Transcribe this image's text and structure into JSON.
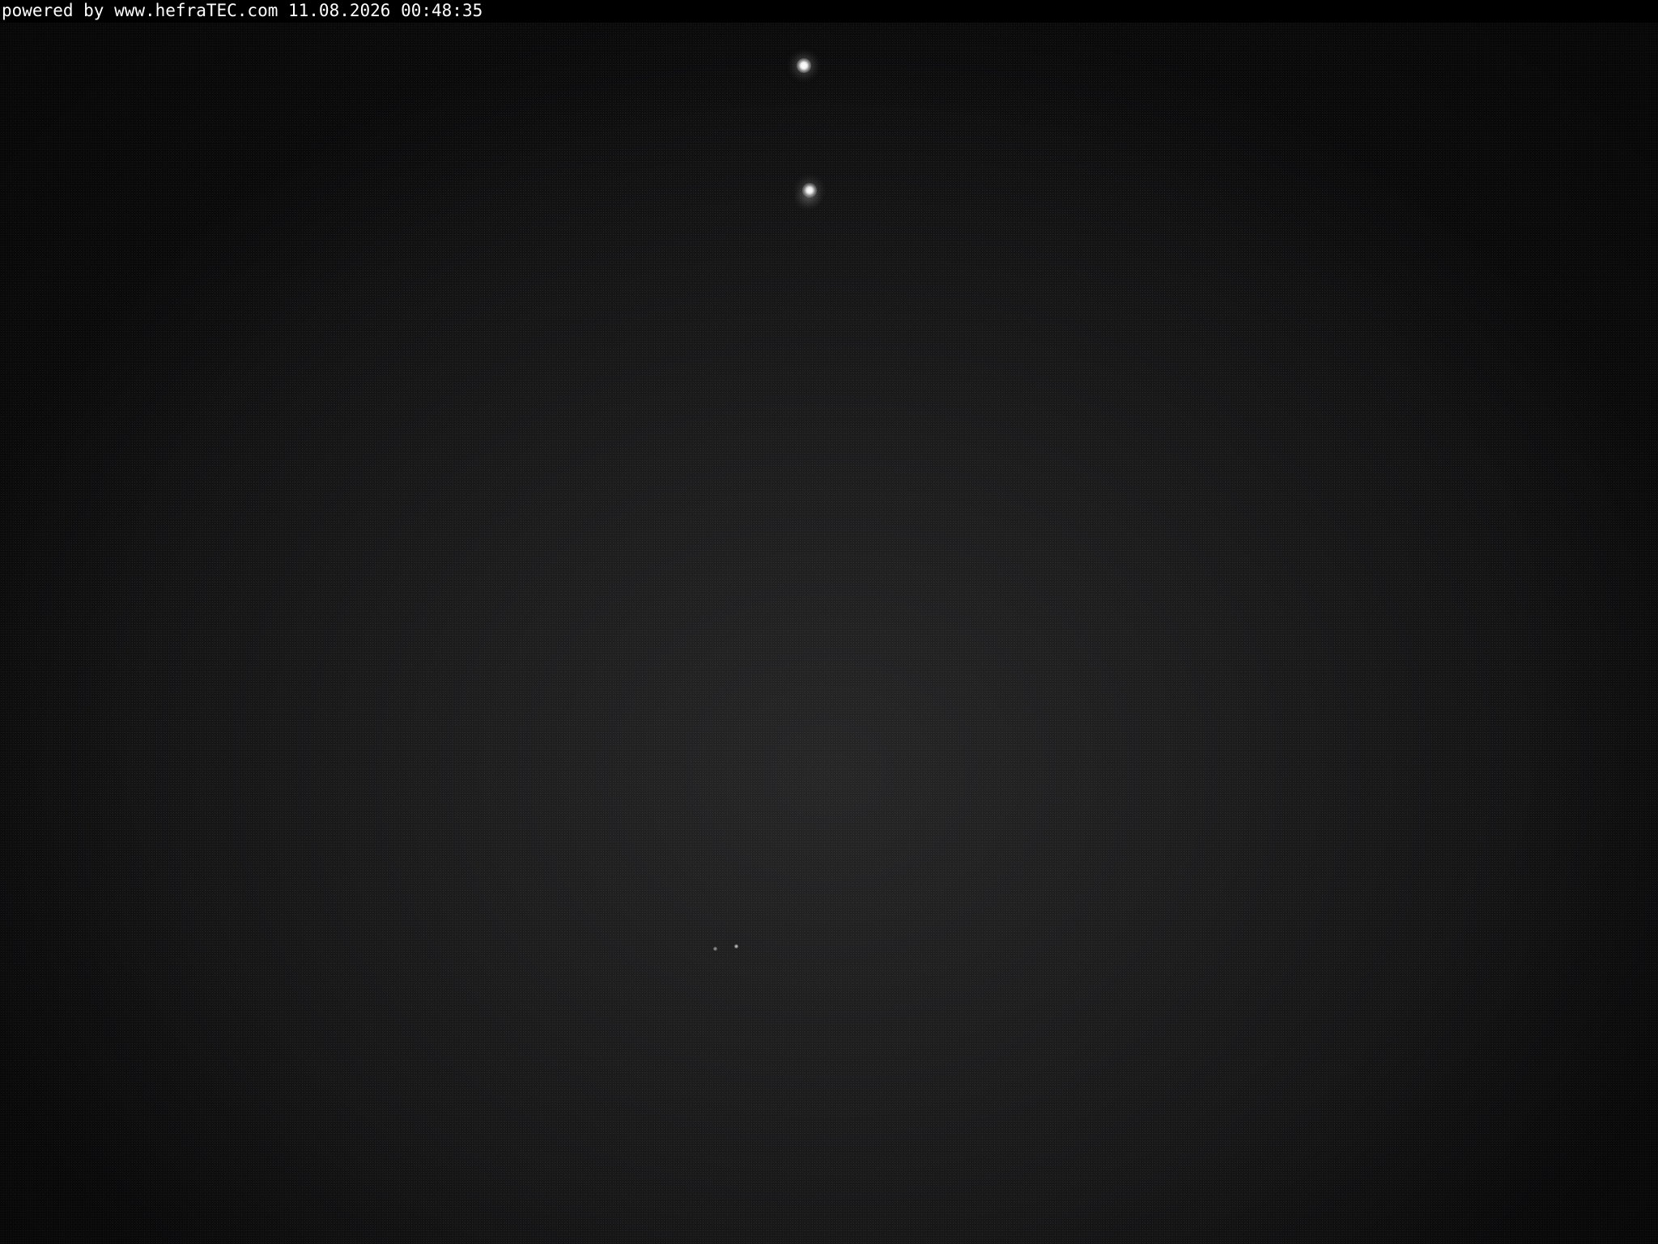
{
  "webcam": {
    "overlay": {
      "caption": "powered by www.hefraTEC.com 11.08.2026 00:48:35"
    },
    "colors": {
      "overlay_background": "#000000",
      "overlay_text": "#ffffff",
      "sky": "#1d1d1e"
    }
  }
}
